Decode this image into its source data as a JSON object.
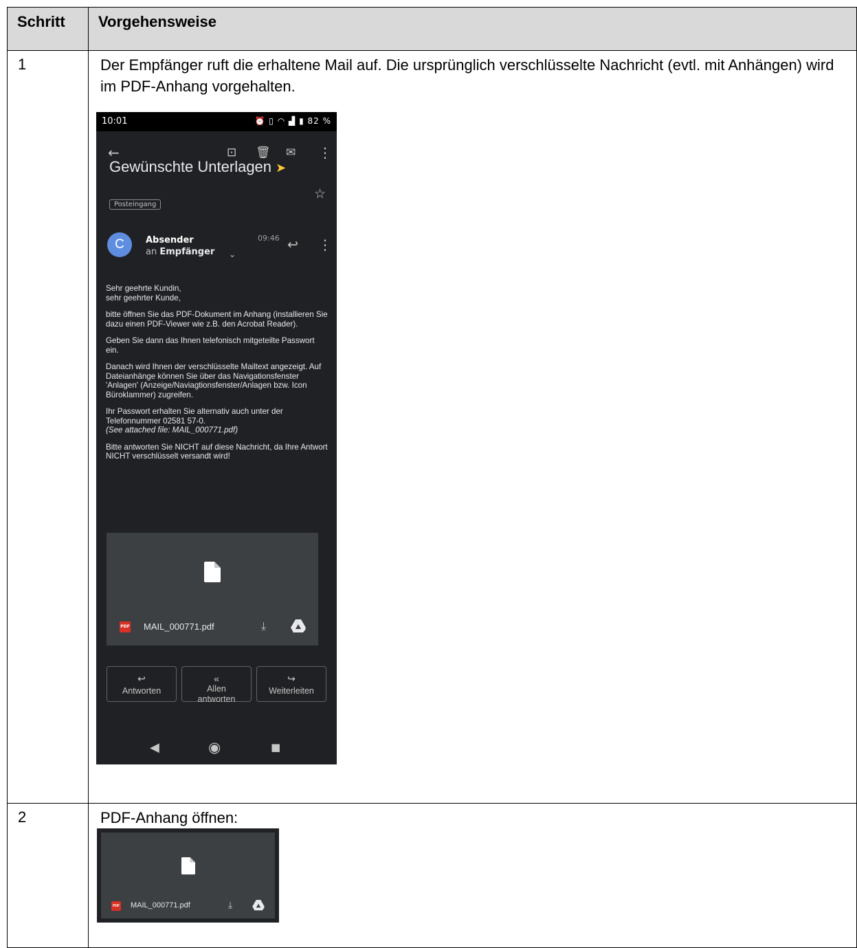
{
  "table": {
    "header": {
      "step": "Schritt",
      "procedure": "Vorgehensweise"
    },
    "rows": [
      {
        "step": "1",
        "text": "Der Empfänger ruft die erhaltene Mail auf. Die ursprünglich verschlüsselte Nachricht (evtl. mit Anhängen) wird im PDF-Anhang vorgehalten."
      },
      {
        "step": "2",
        "text": "PDF-Anhang öffnen:"
      }
    ]
  },
  "phone": {
    "status_time": "10:01",
    "battery": "82 %",
    "subject": "Gewünschte Unterlagen",
    "label": "Posteingang",
    "avatar_letter": "C",
    "sender": "Absender",
    "recipient_prefix": "an",
    "recipient": "Empfänger",
    "time": "09:46",
    "body": {
      "greeting1": "Sehr geehrte Kundin,",
      "greeting2": "sehr geehrter Kunde,",
      "p1": "bitte öffnen Sie das PDF-Dokument im Anhang (installieren Sie dazu einen PDF-Viewer wie z.B. den Acrobat Reader).",
      "p2": "Geben Sie dann das Ihnen telefonisch mitgeteilte Passwort ein.",
      "p3": "Danach wird Ihnen der verschlüsselte Mailtext angezeigt. Auf Dateianhänge können Sie über das Navigationsfenster 'Anlagen' (Anzeige/Naviagtionsfenster/Anlagen bzw. Icon Büroklammer) zugreifen.",
      "p4": "Ihr Passwort erhalten Sie alternativ auch unter der Telefonnummer 02581 57-0.",
      "p4_italic": "(See attached file: MAIL_000771.pdf)",
      "p5": "Bitte antworten Sie NICHT auf diese Nachricht, da Ihre Antwort NICHT verschlüsselt versandt wird!"
    },
    "attachment": {
      "badge": "PDF",
      "filename": "MAIL_000771.pdf"
    },
    "buttons": {
      "reply": "Antworten",
      "reply_all_1": "Allen",
      "reply_all_2": "antworten",
      "forward": "Weiterleiten"
    }
  },
  "crop": {
    "badge": "PDF",
    "filename": "MAIL_000771.pdf"
  }
}
